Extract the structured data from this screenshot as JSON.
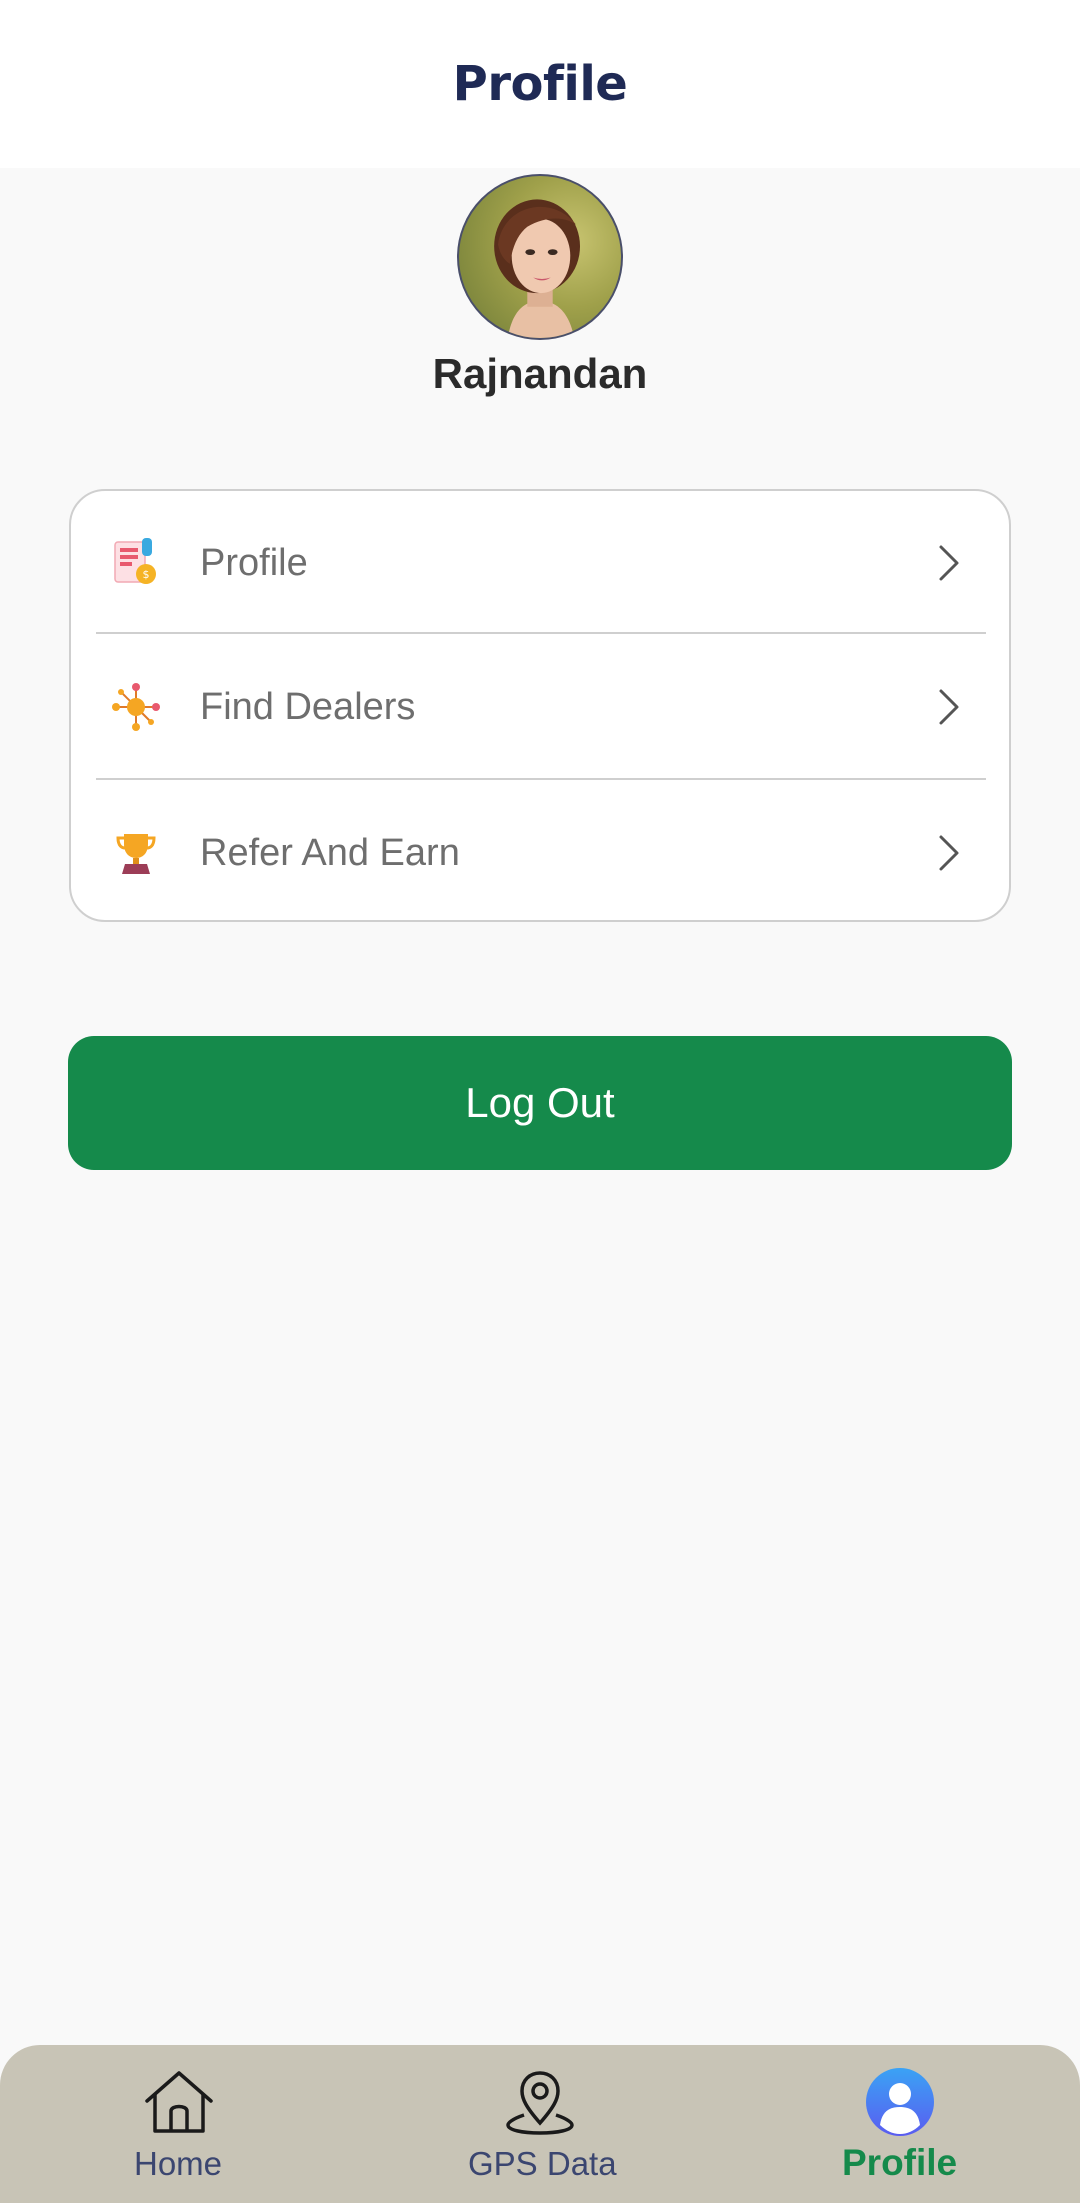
{
  "header": {
    "title": "Profile"
  },
  "user": {
    "name": "Rajnandan"
  },
  "menu": {
    "items": [
      {
        "label": "Profile",
        "icon": "profile-document-icon"
      },
      {
        "label": "Find Dealers",
        "icon": "dealers-network-icon"
      },
      {
        "label": "Refer And Earn",
        "icon": "trophy-icon"
      }
    ]
  },
  "actions": {
    "logout_label": "Log Out"
  },
  "bottom_nav": {
    "items": [
      {
        "label": "Home",
        "icon": "home-icon",
        "active": false
      },
      {
        "label": "GPS Data",
        "icon": "map-pin-icon",
        "active": false
      },
      {
        "label": "Profile",
        "icon": "user-avatar-icon",
        "active": true
      }
    ]
  },
  "colors": {
    "accent": "#158a4b",
    "header_text": "#1f2a55",
    "nav_background": "#c8c4b6",
    "nav_text": "#3b4670"
  }
}
